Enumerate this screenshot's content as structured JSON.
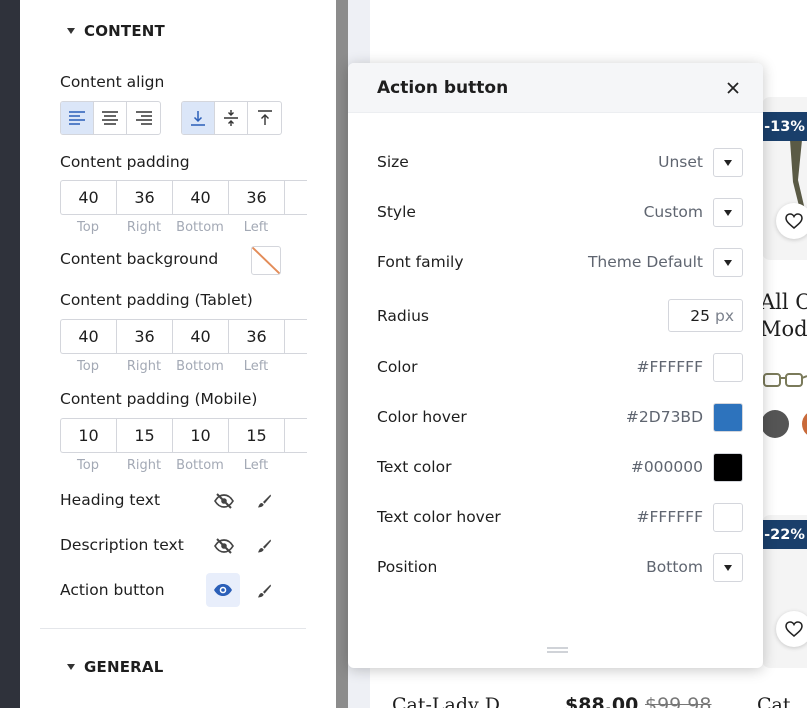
{
  "sidebar": {
    "content_section": {
      "title": "CONTENT"
    },
    "content_align": {
      "label": "Content align",
      "horizontal": [
        "align-left",
        "align-center",
        "align-right"
      ],
      "horizontal_active": "align-left",
      "vertical": [
        "align-bottom",
        "align-middle",
        "align-top"
      ],
      "vertical_active": "align-bottom"
    },
    "content_padding": {
      "label": "Content padding",
      "values": [
        "40",
        "36",
        "40",
        "36"
      ],
      "captions": [
        "Top",
        "Right",
        "Bottom",
        "Left"
      ]
    },
    "content_background": {
      "label": "Content background"
    },
    "content_padding_tablet": {
      "label": "Content padding (Tablet)",
      "values": [
        "40",
        "36",
        "40",
        "36"
      ],
      "captions": [
        "Top",
        "Right",
        "Bottom",
        "Left"
      ]
    },
    "content_padding_mobile": {
      "label": "Content padding (Mobile)",
      "values": [
        "10",
        "15",
        "10",
        "15"
      ],
      "captions": [
        "Top",
        "Right",
        "Bottom",
        "Left"
      ]
    },
    "elements": [
      {
        "label": "Heading text",
        "visible": false
      },
      {
        "label": "Description text",
        "visible": false
      },
      {
        "label": "Action button",
        "visible": true
      }
    ],
    "general_section": {
      "title": "GENERAL"
    }
  },
  "popup": {
    "title": "Action button",
    "rows": {
      "size": {
        "label": "Size",
        "value": "Unset"
      },
      "style": {
        "label": "Style",
        "value": "Custom"
      },
      "font_family": {
        "label": "Font family",
        "value": "Theme Default"
      },
      "radius": {
        "label": "Radius",
        "value": "25",
        "unit": "px"
      },
      "color": {
        "label": "Color",
        "value": "#FFFFFF",
        "swatch": "#FFFFFF"
      },
      "color_hover": {
        "label": "Color hover",
        "value": "#2D73BD",
        "swatch": "#2D73BD"
      },
      "text_color": {
        "label": "Text color",
        "value": "#000000",
        "swatch": "#000000"
      },
      "text_color_hover": {
        "label": "Text color hover",
        "value": "#FFFFFF",
        "swatch": "#FFFFFF"
      },
      "position": {
        "label": "Position",
        "value": "Bottom"
      }
    }
  },
  "preview": {
    "badge_1": "-13%",
    "badge_2": "-22%",
    "product_title_line1": "All O",
    "product_title_line2": "Moda",
    "footer_name": "Cat-Lady D",
    "footer_price": "$88.00",
    "footer_old_price": "$99.98",
    "footer_next": "Cat"
  },
  "colors": {
    "accent": "#2D73BD",
    "badge": "#1A3F6B",
    "active_bg": "#DBE6F8"
  }
}
